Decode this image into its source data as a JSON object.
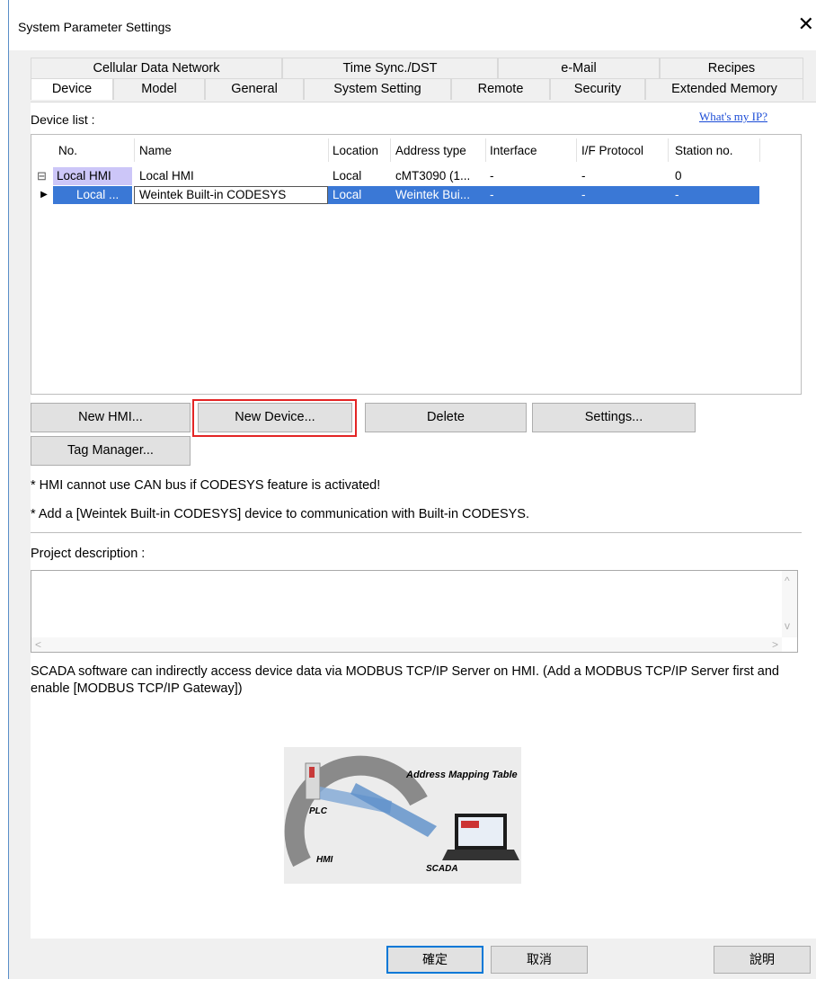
{
  "window": {
    "title": "System Parameter Settings",
    "close_glyph": "✕"
  },
  "tabs_back": [
    "Cellular Data Network",
    "Time Sync./DST",
    "e-Mail",
    "Recipes"
  ],
  "tabs_front": [
    "Device",
    "Model",
    "General",
    "System Setting",
    "Remote",
    "Security",
    "Extended Memory"
  ],
  "device_list": {
    "label": "Device list :",
    "link": "What's my IP?",
    "columns": [
      "No.",
      "Name",
      "Location",
      "Address type",
      "Interface",
      "I/F Protocol",
      "Station no."
    ],
    "rows": [
      {
        "expander": "⊟",
        "no": "Local HMI",
        "name": "Local HMI",
        "location": "Local",
        "address_type": "cMT3090 (1...",
        "interface": "-",
        "protocol": "-",
        "station": "0"
      },
      {
        "expander": "▶",
        "no": "Local ...",
        "name": "Weintek Built-in CODESYS",
        "location": "Local",
        "address_type": "Weintek Bui...",
        "interface": "-",
        "protocol": "-",
        "station": "-"
      }
    ]
  },
  "buttons": {
    "new_hmi": "New HMI...",
    "new_device": "New Device...",
    "delete": "Delete",
    "settings": "Settings...",
    "tag_manager": "Tag Manager..."
  },
  "notes": [
    "* HMI cannot use CAN bus if CODESYS feature is activated!",
    "* Add a [Weintek Built-in CODESYS] device to communication with Built-in CODESYS."
  ],
  "project": {
    "label": "Project description :",
    "value": ""
  },
  "scada_text": "SCADA software can indirectly access device data via MODBUS TCP/IP Server on HMI. (Add a MODBUS TCP/IP Server first and enable [MODBUS TCP/IP Gateway])",
  "diagram": {
    "title": "Address Mapping Table",
    "plc": "PLC",
    "hmi": "HMI",
    "scada": "SCADA"
  },
  "dialog_buttons": {
    "ok": "確定",
    "cancel": "取消",
    "help": "說明"
  },
  "colors": {
    "selection": "#3a78d6",
    "highlight": "#ccc6f8",
    "focus_red": "#e32525"
  }
}
